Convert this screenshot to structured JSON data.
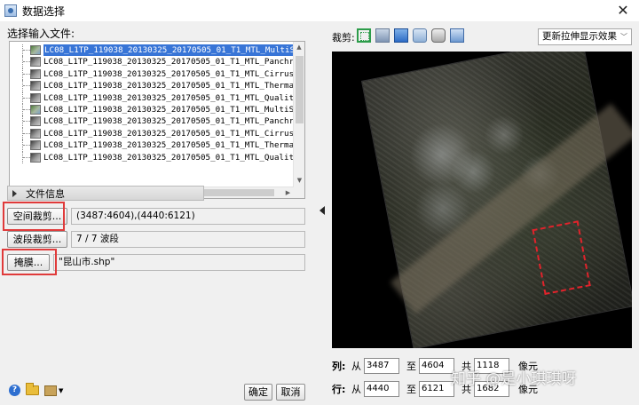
{
  "window": {
    "title": "数据选择",
    "close_glyph": "✕"
  },
  "input": {
    "label": "选择输入文件:",
    "files": [
      "LC08_L1TP_119038_20130325_20170505_01_T1_MTL_MultiSpectral",
      "LC08_L1TP_119038_20130325_20170505_01_T1_MTL_Panchromatic",
      "LC08_L1TP_119038_20130325_20170505_01_T1_MTL_Cirrus",
      "LC08_L1TP_119038_20130325_20170505_01_T1_MTL_Thermal",
      "LC08_L1TP_119038_20130325_20170505_01_T1_MTL_Quality",
      "LC08_L1TP_119038_20130325_20170505_01_T1_MTL_MultiSpectral",
      "LC08_L1TP_119038_20130325_20170505_01_T1_MTL_Panchromatic",
      "LC08_L1TP_119038_20130325_20170505_01_T1_MTL_Cirrus",
      "LC08_L1TP_119038_20130325_20170505_01_T1_MTL_Thermal",
      "LC08_L1TP_119038_20130325_20170505_01_T1_MTL_Quality"
    ],
    "selected_index": 0
  },
  "fileinfo": {
    "label": "文件信息"
  },
  "spatial": {
    "button": "空间裁剪...",
    "value": "(3487:4604),(4440:6121)"
  },
  "band": {
    "button": "波段裁剪...",
    "value": "7 / 7 波段"
  },
  "mask": {
    "button": "掩膜...",
    "value": "\"昆山市.shp\""
  },
  "footer": {
    "ok": "确定",
    "cancel": "取消",
    "help_glyph": "?"
  },
  "preview": {
    "crop_label": "裁剪:",
    "stretch_option": "更新拉伸显示效果",
    "cols": {
      "axis": "列:",
      "from_label": "从",
      "from": "3487",
      "to_label": "至",
      "to": "4604",
      "total_label": "共",
      "total": "1118",
      "unit": "像元"
    },
    "rows": {
      "axis": "行:",
      "from_label": "从",
      "from": "4440",
      "to_label": "至",
      "to": "6121",
      "total_label": "共",
      "total": "1682",
      "unit": "像元"
    }
  },
  "watermark": "知乎 @是小琪琪呀",
  "colors": {
    "highlight": "#e03b3b",
    "selection": "#3875d7",
    "roi": "#e0232b"
  }
}
